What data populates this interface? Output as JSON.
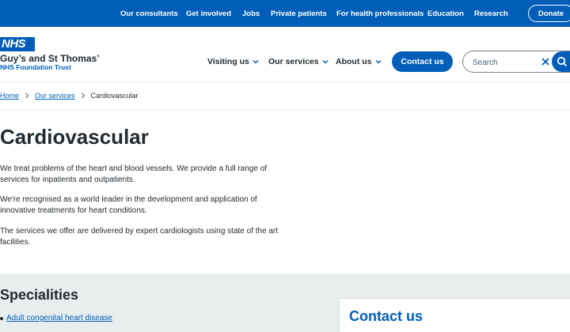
{
  "top_nav": {
    "items": [
      "Our consultants",
      "Get involved",
      "Jobs",
      "Private patients",
      "For health professionals",
      "Education",
      "Research"
    ],
    "donate": "Donate"
  },
  "header": {
    "logo_text": "NHS",
    "org_name": "Guy’s and St Thomas’",
    "org_trust": "NHS Foundation Trust",
    "nav": [
      "Visiting us",
      "Our services",
      "About us"
    ],
    "contact_label": "Contact us",
    "search_placeholder": "Search"
  },
  "breadcrumb": [
    "Home",
    "Our services",
    "Cardiovascular"
  ],
  "main": {
    "title": "Cardiovascular",
    "paragraphs": [
      [
        "We treat problems of the heart and blood vessels. We provide a full range of",
        "services for inpatients and outpatients."
      ],
      [
        "We're recognised as a world leader in the development and application of",
        "innovative treatments for heart conditions."
      ],
      [
        "The services we offer are delivered by expert cardiologists using state of the art",
        "facilities."
      ]
    ]
  },
  "specialities": {
    "title": "Specialities",
    "items": [
      "Adult congenital heart disease"
    ]
  },
  "contact_card": {
    "title": "Contact us"
  },
  "colors": {
    "brand_blue": "#005eb8",
    "text": "#212b32",
    "grey_band": "#e8edee"
  }
}
